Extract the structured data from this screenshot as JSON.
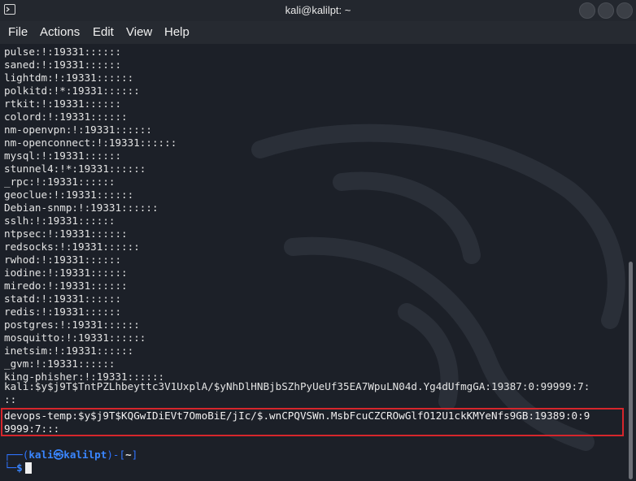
{
  "window": {
    "title": "kali@kalilpt: ~"
  },
  "menu": {
    "file": "File",
    "actions": "Actions",
    "edit": "Edit",
    "view": "View",
    "help": "Help"
  },
  "terminal": {
    "lines": [
      "pulse:!:19331::::::",
      "saned:!:19331::::::",
      "lightdm:!:19331::::::",
      "polkitd:!*:19331::::::",
      "rtkit:!:19331::::::",
      "colord:!:19331::::::",
      "nm-openvpn:!:19331::::::",
      "nm-openconnect:!:19331::::::",
      "mysql:!:19331::::::",
      "stunnel4:!*:19331::::::",
      "_rpc:!:19331::::::",
      "geoclue:!:19331::::::",
      "Debian-snmp:!:19331::::::",
      "sslh:!:19331::::::",
      "ntpsec:!:19331::::::",
      "redsocks:!:19331::::::",
      "rwhod:!:19331::::::",
      "iodine:!:19331::::::",
      "miredo:!:19331::::::",
      "statd:!:19331::::::",
      "redis:!:19331::::::",
      "postgres:!:19331::::::",
      "mosquitto:!:19331::::::",
      "inetsim:!:19331::::::",
      "_gvm:!:19331::::::",
      "king-phisher:!:19331::::::"
    ],
    "kali_line_1": "kali:$y$j9T$TntPZLhbeyttc3V1UxplA/$yNhDlHNBjbSZhPyUeUf35EA7WpuLN04d.Yg4dUfmgGA:19387:0:99999:7:",
    "kali_line_2": "::",
    "devops_line_1": "devops-temp:$y$j9T$KQGwIDiEVt7OmoBiE/jIc/$.wnCPQVSWn.MsbFcuCZCROwGlfO12U1ckKMYeNfs9GB:19389:0:9",
    "devops_line_2": "9999:7:::",
    "prompt": {
      "open": "┌──(",
      "user": "kali㉿kalilpt",
      "close": ")-[",
      "path": "~",
      "end": "]",
      "second_prefix": "└─",
      "symbol": "$"
    }
  },
  "colors": {
    "highlight_border": "#d6262c",
    "prompt_blue": "#2f74ff",
    "background": "#1c2028"
  }
}
